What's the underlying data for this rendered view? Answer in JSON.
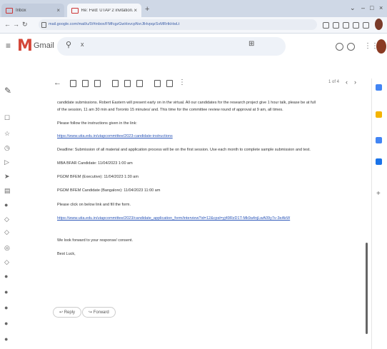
{
  "browser": {
    "tab_inactive": "Inbox",
    "tab_active": "Re: Fwd: UTAP 2 invitation...",
    "url": "mail.google.com/mail/u/0/#inbox/FMfcgzGwHxvcpNvrJlHvpqzSvMRrtkHwLt"
  },
  "gmail": {
    "logo_letter": "M",
    "app_name": "Gmail",
    "search_clear": "x"
  },
  "toolbar": {
    "pager": "1 of 4"
  },
  "email": {
    "para1_line1": "candidate submissions. Robert Eastern will present early on in the virtual. All our candidates for the research project give 1 hour talk, please be at full",
    "para1_line2": "of the session, 11 am 30 min and Toronto 15 minutes/ and. This time for the committee review round of approval at 9 am, all times.",
    "line_register": "Please follow the instructions given in the link:",
    "link1": "https://www.utia.edu.in/utapcommittee/2023-candidate-instructions",
    "line_deadline": "Deadline: Submission of all material and application process will be on the first session.  Use each month to complete sample submission and test.",
    "line_slot1": "MBA BFAR Candidate: 11/04/2023 1:00 am",
    "line_slot2": "PGDM BFEM (Executive): 11/04/2023 1:30 am",
    "line_slot3": "PGDM BFEM Candidate (Bangalore): 11/04/2023 11:00 am",
    "line_join": "Please click on below link and fill the form.",
    "link2": "https://www.utia.edu.in/utapcommittee/2023/candidate_application_form/interview?id=12&cpsl=yj49RzD1T-Mk9a4njLwA09y7v-3eAkW",
    "line_closing": "We look forward to your response/ consent.",
    "line_signoff": "Best Luck,",
    "reply_label": "Reply",
    "forward_label": "Forward"
  }
}
